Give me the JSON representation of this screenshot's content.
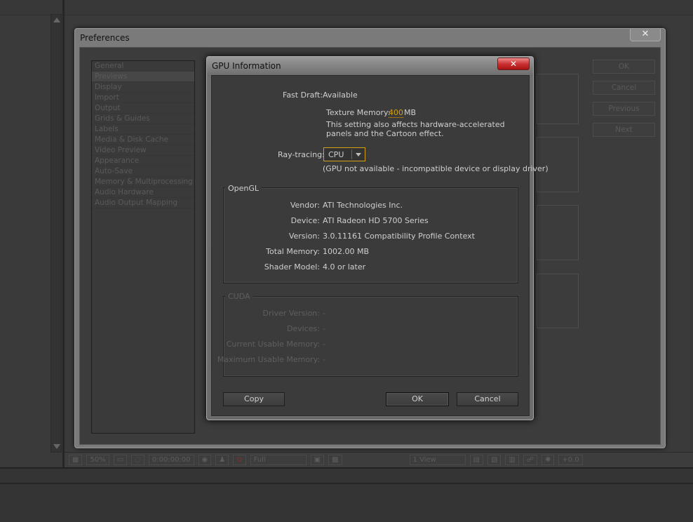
{
  "preferences": {
    "title": "Preferences",
    "close_label": "✕",
    "categories": [
      "General",
      "Previews",
      "Display",
      "Import",
      "Output",
      "Grids & Guides",
      "Labels",
      "Media & Disk Cache",
      "Video Preview",
      "Appearance",
      "Auto-Save",
      "Memory & Multiprocessing",
      "Audio Hardware",
      "Audio Output Mapping"
    ],
    "selected": "Previews",
    "buttons": {
      "ok": "OK",
      "cancel": "Cancel",
      "previous": "Previous",
      "next": "Next"
    }
  },
  "gpu_dialog": {
    "title": "GPU Information",
    "close_label": "✕",
    "fast_draft": {
      "label": "Fast Draft:",
      "value": "Available"
    },
    "texture_memory": {
      "label": "Texture Memory:",
      "value": "400",
      "unit": "MB"
    },
    "note_line1": "This setting also affects hardware-accelerated",
    "note_line2": "panels and the Cartoon effect.",
    "ray_tracing": {
      "label": "Ray-tracing:",
      "value": "CPU",
      "note": "(GPU not available - incompatible device or display driver)"
    },
    "opengl": {
      "title": "OpenGL",
      "rows": [
        {
          "label": "Vendor:",
          "value": "ATI Technologies Inc."
        },
        {
          "label": "Device:",
          "value": "ATI Radeon HD 5700 Series"
        },
        {
          "label": "Version:",
          "value": "3.0.11161 Compatibility Profile Context"
        },
        {
          "label": "Total Memory:",
          "value": "1002.00 MB"
        },
        {
          "label": "Shader Model:",
          "value": "4.0 or later"
        }
      ]
    },
    "cuda": {
      "title": "CUDA",
      "rows": [
        {
          "label": "Driver Version:",
          "value": "-"
        },
        {
          "label": "Devices:",
          "value": "-"
        },
        {
          "label": "Current Usable Memory:",
          "value": "-"
        },
        {
          "label": "Maximum Usable Memory:",
          "value": "-"
        }
      ]
    },
    "buttons": {
      "copy": "Copy",
      "ok": "OK",
      "cancel": "Cancel"
    }
  },
  "viewer_bar": {
    "zoom": "50%",
    "timecode": "0:00:00:00",
    "resolution": "Full",
    "views": "1 View",
    "exposure": "+0.0"
  },
  "colors": {
    "accent": "#d4a017",
    "close_red": "#c33333",
    "background": "#3a3a3a"
  }
}
